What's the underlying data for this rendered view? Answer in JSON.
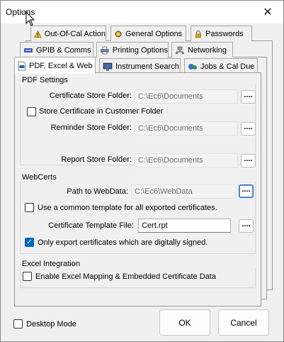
{
  "window": {
    "title": "Options",
    "close_glyph": "✕"
  },
  "tabs": {
    "row1": [
      "Out-Of-Cal Action",
      "General Options",
      "Passwords"
    ],
    "row2": [
      "GPIB & Comms",
      "Printing Options",
      "Networking"
    ],
    "row3": [
      "PDF, Excel & Web",
      "Instrument Search",
      "Jobs & Cal Due"
    ],
    "active": "PDF, Excel & Web"
  },
  "pdf_settings": {
    "title": "PDF Settings",
    "cert_store_label": "Certificate Store Folder:",
    "cert_store_value": "C:\\Ec6\\Documents",
    "store_in_customer_label": "Store Certificate in Customer Folder",
    "store_in_customer_checked": false,
    "reminder_store_label": "Reminder Store Folder:",
    "reminder_store_value": "C:\\Ec6\\Documents",
    "report_store_label": "Report Store Folder:",
    "report_store_value": "C:\\Ec6\\Documents"
  },
  "webcerts": {
    "title": "WebCerts",
    "path_label": "Path to WebData:",
    "path_value": "C:\\Ec6\\WebData",
    "common_template_label": "Use a common template for all exported certificates.",
    "common_template_checked": false,
    "template_file_label": "Certificate Template File:",
    "template_file_value": "Cert.rpt",
    "only_signed_label": "Only export certificates which are digitally signed.",
    "only_signed_checked": true
  },
  "excel": {
    "title": "Excel Integration",
    "enable_label": "Enable Excel Mapping & Embedded Certificate Data",
    "enable_checked": false
  },
  "footer": {
    "desktop_mode_label": "Desktop Mode",
    "desktop_mode_checked": false,
    "ok_label": "OK",
    "cancel_label": "Cancel"
  },
  "browse_label": "....",
  "colors": {
    "accent": "#0067c0",
    "focus": "#2b6cc4"
  },
  "icons": [
    "warning-icon",
    "gear-icon",
    "padlock-icon",
    "gpib-icon",
    "printer-icon",
    "network-icon",
    "pdf-icon",
    "monitor-icon",
    "jobs-icon",
    "arrow-cursor-icon"
  ]
}
